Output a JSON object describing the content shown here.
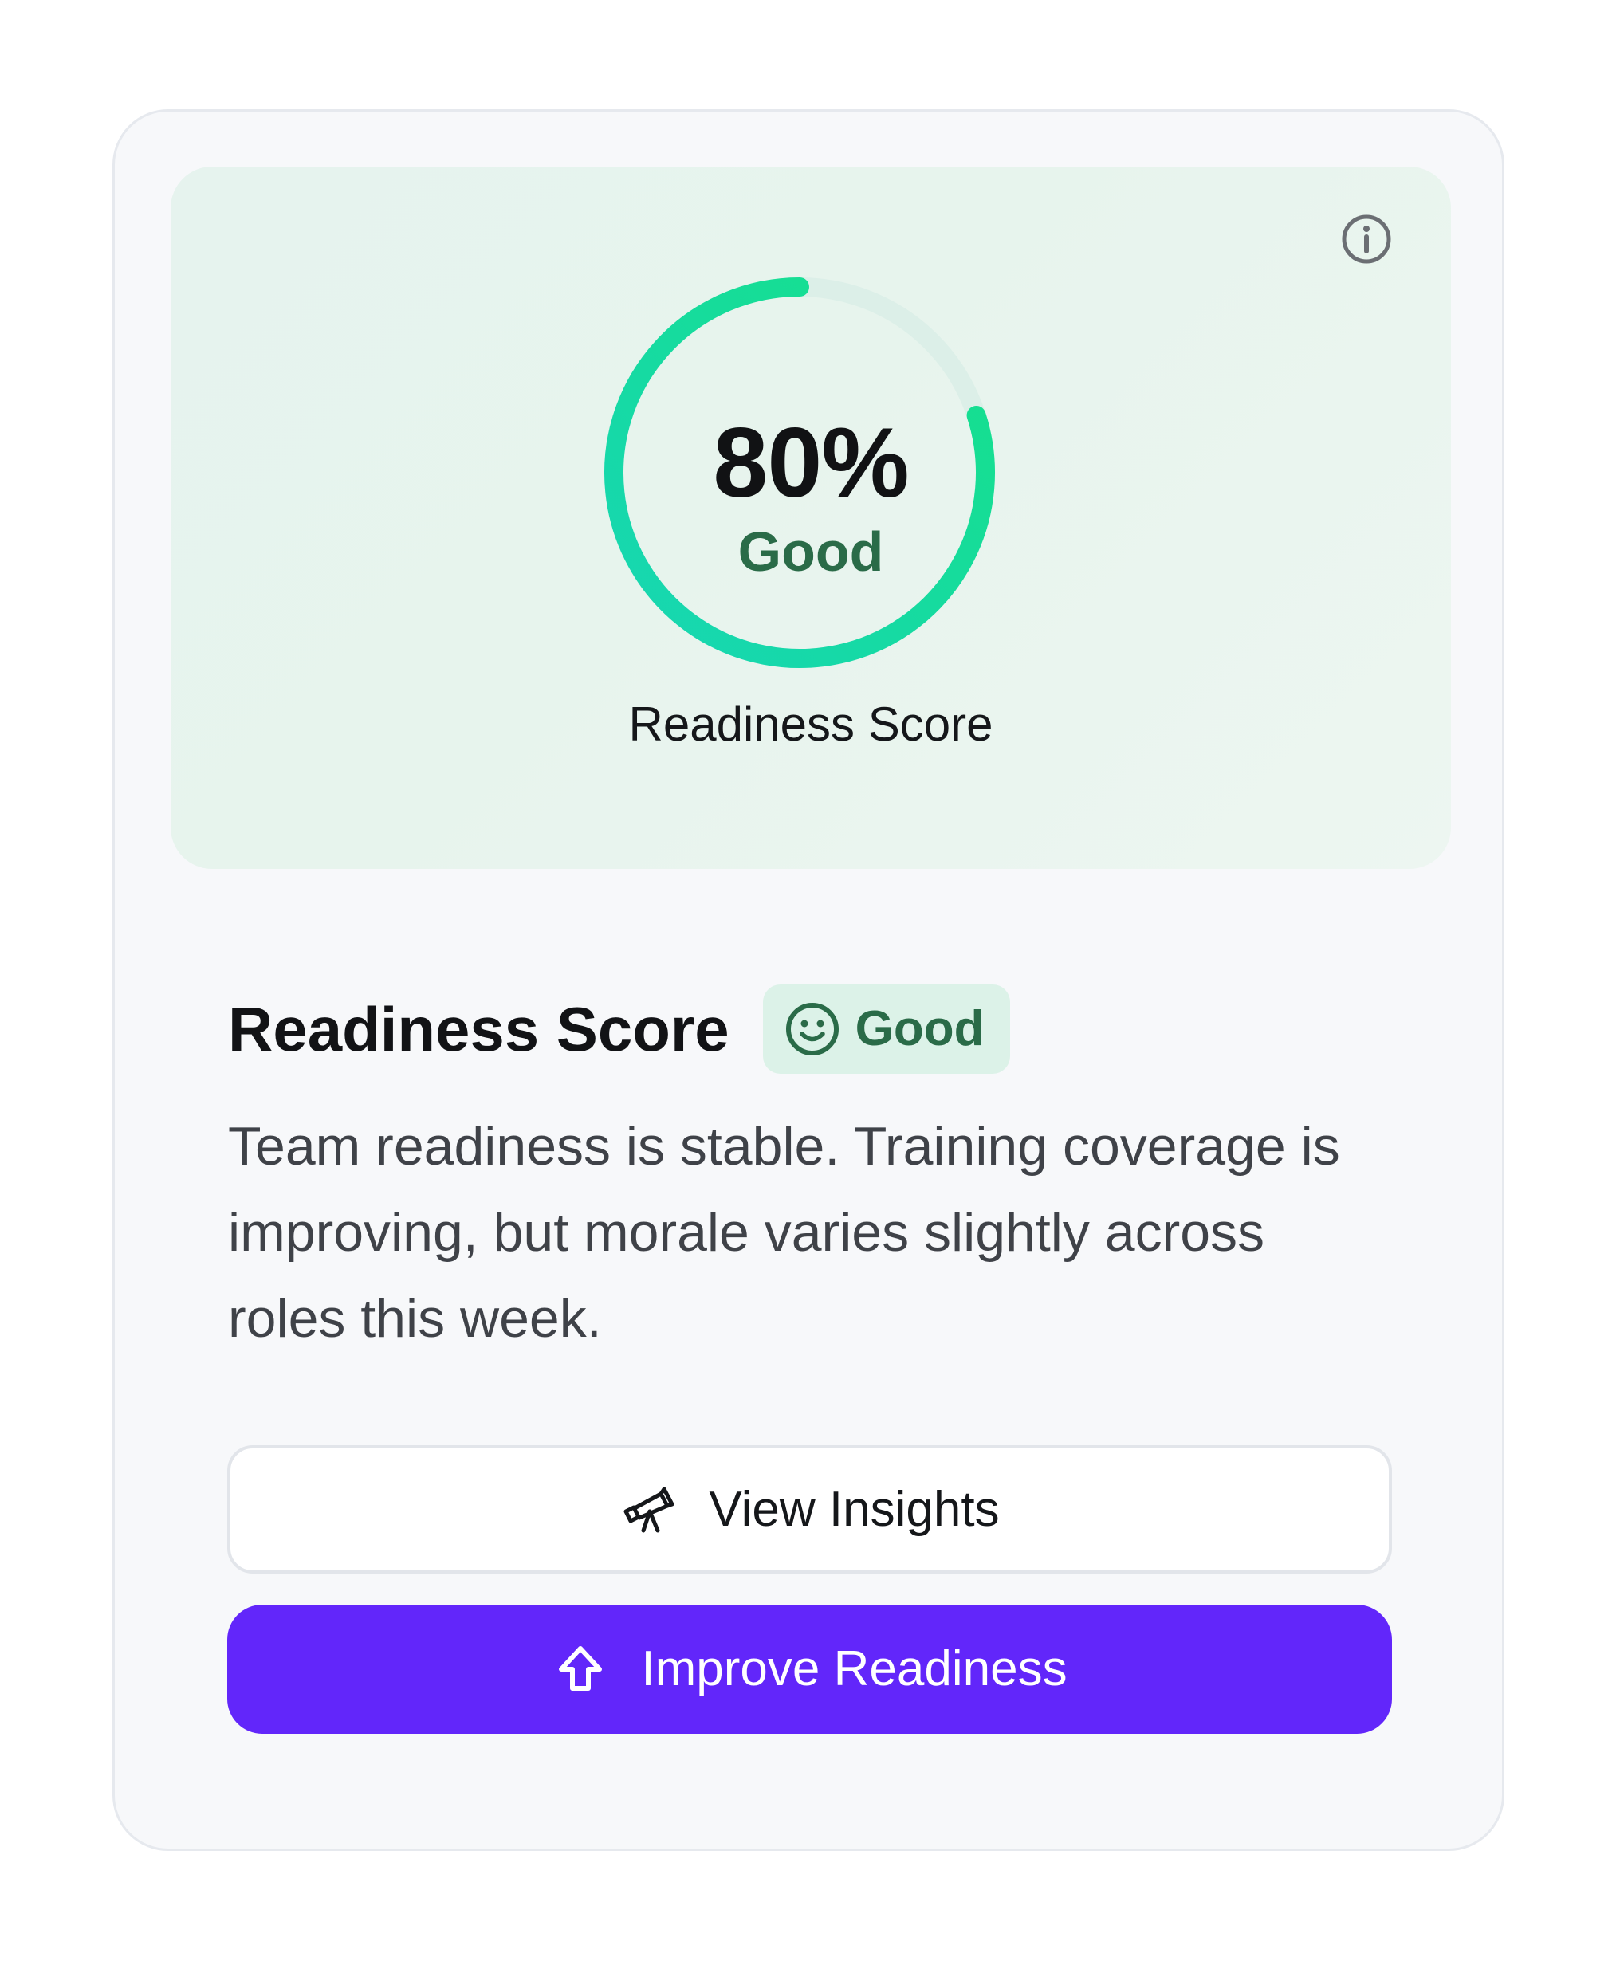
{
  "hero": {
    "score_value": "80%",
    "score_fraction": 0.8,
    "status_label": "Good",
    "caption": "Readiness Score",
    "ring_colors": {
      "start": "#17d6b4",
      "end": "#15e08a",
      "track": "#dcefe8"
    },
    "info_icon": "info-icon"
  },
  "details": {
    "title": "Readiness Score",
    "badge": {
      "label": "Good",
      "icon": "smiley-icon",
      "background": "#dcf2e8",
      "color": "#2a6b48"
    },
    "description": "Team readiness is stable. Training coverage is improving, but morale varies slightly across roles this week."
  },
  "actions": {
    "view_insights": {
      "label": "View Insights",
      "icon": "telescope-icon"
    },
    "improve": {
      "label": "Improve Readiness",
      "icon": "arrow-up-icon",
      "background": "#6226fa"
    }
  }
}
